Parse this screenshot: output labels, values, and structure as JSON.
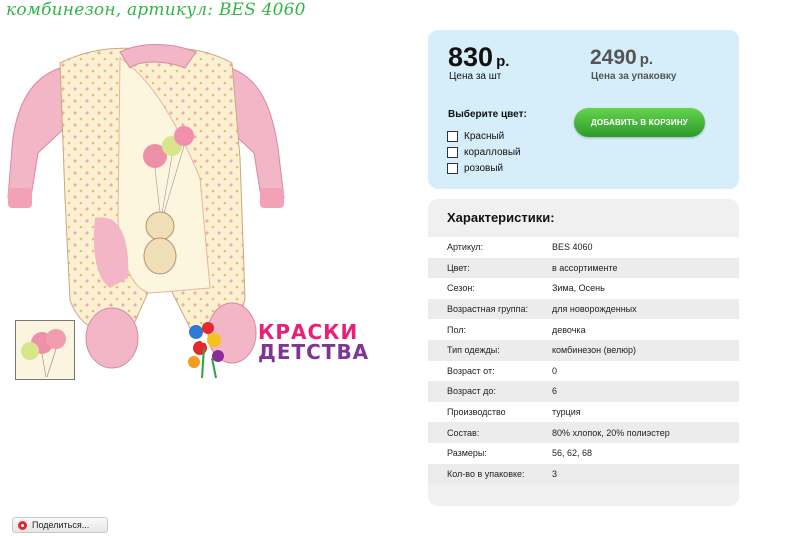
{
  "page": {
    "title": "комбинезон, артикул: BES 4060"
  },
  "logo": {
    "line1": "КРАСКИ",
    "line2": "ДЕТСТВА"
  },
  "price": {
    "unit_value": "830",
    "unit_currency": "р.",
    "unit_label": "Цена за шт",
    "pack_value": "2490",
    "pack_currency": "р.",
    "pack_label": "Цена за упаковку"
  },
  "color_select": {
    "label": "Выберите цвет:",
    "options": [
      "Красный",
      "коралловый",
      "розовый"
    ]
  },
  "cart": {
    "add_label": "ДОБАВИТЬ В КОРЗИНУ"
  },
  "specs": {
    "title": "Характеристики:",
    "rows": [
      {
        "k": "Артикул:",
        "v": "BES 4060"
      },
      {
        "k": "Цвет:",
        "v": "в ассортименте"
      },
      {
        "k": "Сезон:",
        "v": "Зима, Осень"
      },
      {
        "k": "Возрастная группа:",
        "v": "для новорожденных"
      },
      {
        "k": "Пол:",
        "v": "девочка"
      },
      {
        "k": "Тип одежды:",
        "v": "комбинезон (велюр)"
      },
      {
        "k": "Возраст от:",
        "v": "0"
      },
      {
        "k": "Возраст до:",
        "v": "6"
      },
      {
        "k": "Производство",
        "v": "турция"
      },
      {
        "k": "Состав:",
        "v": "80% хлопок, 20% полиэстер"
      },
      {
        "k": "Размеры:",
        "v": "56, 62, 68"
      },
      {
        "k": "Кол-во в упаковке:",
        "v": "3"
      }
    ]
  },
  "share": {
    "label": "Поделиться..."
  },
  "colors": {
    "title_green": "#33b54a",
    "button_green": "#3aab36",
    "price_bg": "#d5eefa",
    "spec_bg": "#f0f0f0",
    "pink": "#f0a5b8"
  }
}
